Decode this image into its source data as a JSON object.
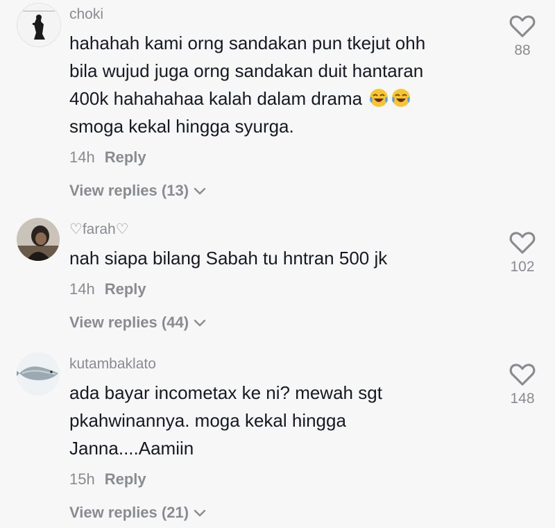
{
  "comments": [
    {
      "username": "choki",
      "text_lines": [
        "hahahah kami orng sandakan pun tkejut ohh",
        "bila wujud juga orng sandakan duit hantaran",
        "400k hahahahaa kalah dalam drama ",
        "smoga kekal hingga syurga."
      ],
      "emoji": "face-with-tears-of-joy",
      "time": "14h",
      "reply_label": "Reply",
      "view_replies": "View replies (13)",
      "likes": "88"
    },
    {
      "username": "♡farah♡",
      "text_lines": [
        "nah siapa bilang Sabah tu hntran 500 jk"
      ],
      "time": "14h",
      "reply_label": "Reply",
      "view_replies": "View replies (44)",
      "likes": "102"
    },
    {
      "username": "kutambaklato",
      "text_lines": [
        "ada bayar incometax ke ni? mewah sgt",
        "pkahwinannya. moga kekal hingga",
        "Janna....Aamiin"
      ],
      "time": "15h",
      "reply_label": "Reply",
      "view_replies": "View replies (21)",
      "likes": "148"
    }
  ],
  "colors": {
    "background": "#f7f7f7",
    "text": "#161823",
    "secondary": "#8a8b91"
  }
}
